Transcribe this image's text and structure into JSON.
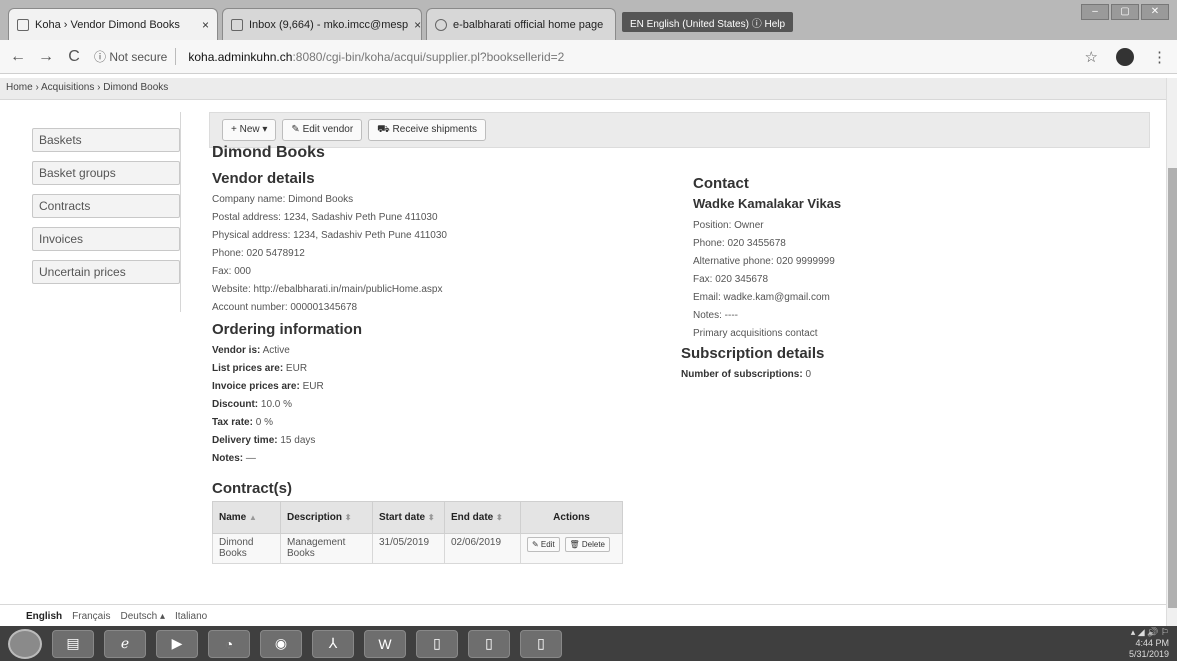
{
  "browser": {
    "tabs": [
      {
        "label": "Koha › Vendor Dimond Books",
        "close": "×"
      },
      {
        "label": "Inbox (9,664) - mko.imcc@mesp",
        "close": "×"
      },
      {
        "label": "e-balbharati official home page",
        "close": ""
      }
    ],
    "lang_chip": "EN English (United States)   ⓘ Help",
    "back": "←",
    "forward": "→",
    "reload": "C",
    "security": "ⓘ Not secure",
    "url_host": "koha.adminkuhn.ch",
    "url_path": ":8080/cgi-bin/koha/acqui/supplier.pl?booksellerid=2",
    "star": "☆",
    "menu": "⋮"
  },
  "breadcrumb": "Home › Acquisitions › Dimond Books",
  "sidebar": {
    "items": [
      {
        "label": "Baskets"
      },
      {
        "label": "Basket groups"
      },
      {
        "label": "Contracts"
      },
      {
        "label": "Invoices"
      },
      {
        "label": "Uncertain prices"
      }
    ]
  },
  "toolbar": {
    "new_label": "+ New ▾",
    "edit_label": "✎ Edit vendor",
    "receive_label": "⛟ Receive shipments"
  },
  "vendor": {
    "title": "Dimond Books",
    "details_heading": "Vendor details",
    "company_name": "Company name: Dimond Books",
    "postal_address": "Postal address: 1234, Sadashiv Peth Pune 411030",
    "physical_address": "Physical address: 1234, Sadashiv Peth Pune 411030",
    "phone": "Phone: 020 5478912",
    "fax": "Fax: 000",
    "website": "Website: http://ebalbharati.in/main/publicHome.aspx",
    "account_number": "Account number: 000001345678"
  },
  "ordering": {
    "heading": "Ordering information",
    "rows": [
      {
        "label": "Vendor is:",
        "value": " Active"
      },
      {
        "label": "List prices are:",
        "value": " EUR"
      },
      {
        "label": "Invoice prices are:",
        "value": " EUR"
      },
      {
        "label": "Discount:",
        "value": " 10.0 %"
      },
      {
        "label": "Tax rate:",
        "value": " 0 %"
      },
      {
        "label": "Delivery time:",
        "value": " 15 days"
      },
      {
        "label": "Notes:",
        "value": " —"
      }
    ]
  },
  "contact": {
    "heading": "Contact",
    "name": "Wadke Kamalakar Vikas",
    "position": "Position: Owner",
    "phone": "Phone: 020 3455678",
    "alt_phone": "Alternative phone: 020 9999999",
    "fax": "Fax: 020 345678",
    "email": "Email: wadke.kam@gmail.com",
    "notes": "Notes: ----",
    "primary": "Primary acquisitions contact"
  },
  "subscription": {
    "heading": "Subscription details",
    "label": "Number of subscriptions:",
    "value": " 0"
  },
  "contracts": {
    "heading": "Contract(s)",
    "columns": [
      "Name",
      "Description",
      "Start date",
      "End date",
      "Actions"
    ],
    "sort_marks": [
      "▲",
      "⬍",
      "⬍",
      "⬍"
    ],
    "rows": [
      {
        "name": "Dimond Books",
        "description": "Management Books",
        "start": "31/05/2019",
        "end": "02/06/2019",
        "edit": "✎ Edit",
        "delete": "🗑 Delete"
      }
    ]
  },
  "languages": {
    "current": "English",
    "others": [
      "Français",
      "Deutsch ▴",
      "Italiano"
    ]
  },
  "taskbar": {
    "word_label": "W",
    "time": "4:44 PM",
    "date": "5/31/2019",
    "tray_icons": "▴ ◢ 🔊 ⚐"
  }
}
